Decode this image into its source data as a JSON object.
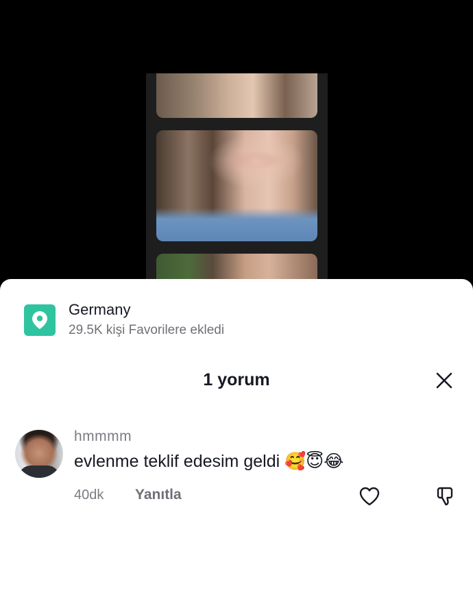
{
  "location": {
    "name": "Germany",
    "favorites": "29.5K kişi Favorilere ekledi"
  },
  "comments_header": {
    "title": "1 yorum",
    "close_icon": "close-icon"
  },
  "comments": [
    {
      "username": "hmmmm",
      "text": "evlenme teklif edesim geldi 🥰😇😂",
      "time": "40dk",
      "reply_label": "Yanıtla",
      "like_icon": "heart-icon",
      "dislike_icon": "thumbs-down-icon"
    }
  ],
  "colors": {
    "location_badge": "#2ec4a0",
    "text_primary": "#161823",
    "text_secondary": "#7b7c83"
  }
}
